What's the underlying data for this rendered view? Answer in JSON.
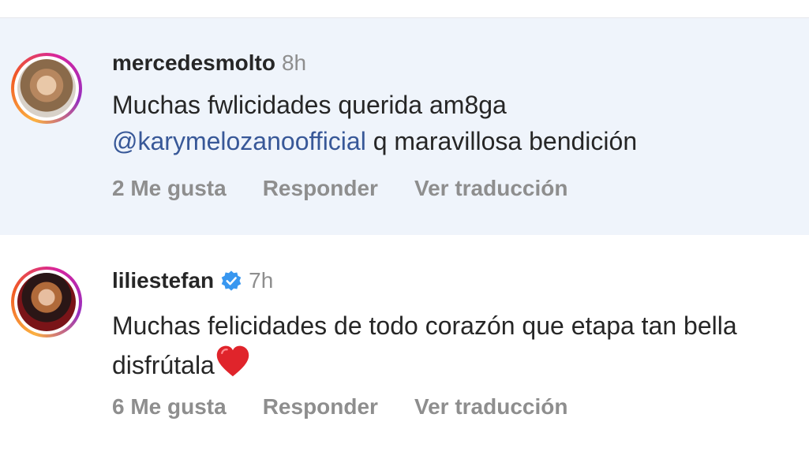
{
  "comments": [
    {
      "username": "mercedesmolto",
      "time": "8h",
      "verified": false,
      "text_line1": "Muchas fwlicidades querida am8ga",
      "mention": "@karymelozanoofficial",
      "text_rest": " q maravillosa bendición",
      "likes": "2 Me gusta",
      "reply": "Responder",
      "translate": "Ver traducción"
    },
    {
      "username": "liliestefan",
      "time": "7h",
      "verified": true,
      "text": "Muchas felicidades de todo corazón que etapa tan bella disfrútala",
      "emoji": "heart-icon",
      "likes": "6 Me gusta",
      "reply": "Responder",
      "translate": "Ver traducción"
    }
  ],
  "colors": {
    "highlight_bg": "#eff4fb",
    "mention": "#385898",
    "muted": "#8e8e8e",
    "verified": "#3897f0",
    "heart": "#e0242b"
  }
}
